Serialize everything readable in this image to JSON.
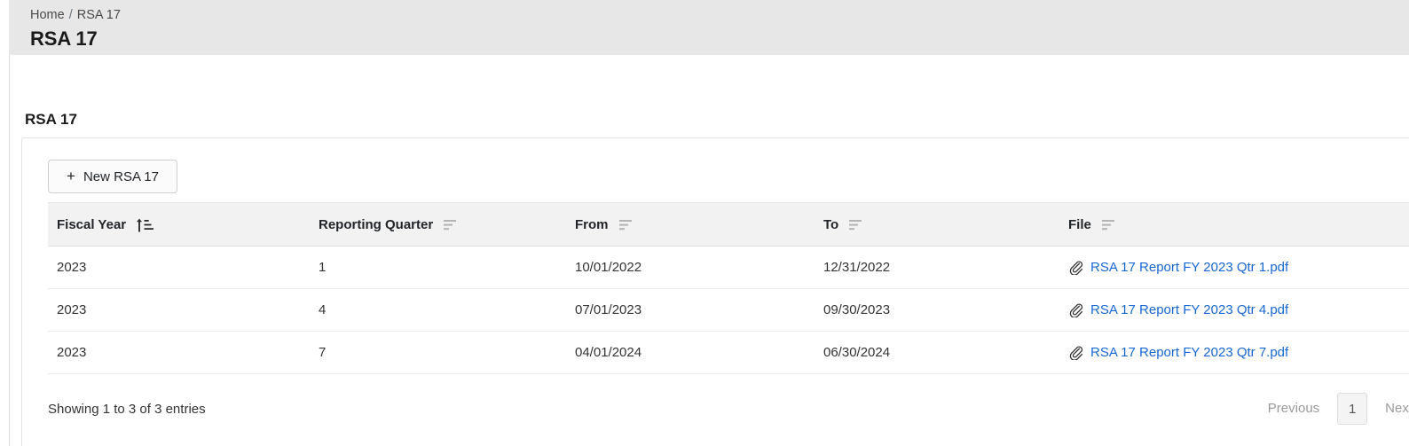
{
  "header": {
    "breadcrumb": {
      "home": "Home",
      "separator": "/",
      "current": "RSA 17"
    },
    "title": "RSA 17"
  },
  "section": {
    "title": "RSA 17"
  },
  "toolbar": {
    "new_button_label": "New RSA 17",
    "new_button_icon": "plus-icon"
  },
  "table": {
    "columns": [
      {
        "label": "Fiscal Year",
        "sort_icon": "sort-ascending-icon",
        "sort_state": "asc"
      },
      {
        "label": "Reporting Quarter",
        "sort_icon": "sort-icon",
        "sort_state": "none"
      },
      {
        "label": "From",
        "sort_icon": "sort-icon",
        "sort_state": "none"
      },
      {
        "label": "To",
        "sort_icon": "sort-icon",
        "sort_state": "none"
      },
      {
        "label": "File",
        "sort_icon": "sort-icon",
        "sort_state": "none"
      }
    ],
    "rows": [
      {
        "fiscal_year": "2023",
        "reporting_quarter": "1",
        "from": "10/01/2022",
        "to": "12/31/2022",
        "file_name": "RSA 17 Report FY 2023 Qtr 1.pdf",
        "file_icon": "paperclip-icon"
      },
      {
        "fiscal_year": "2023",
        "reporting_quarter": "4",
        "from": "07/01/2023",
        "to": "09/30/2023",
        "file_name": "RSA 17 Report FY 2023 Qtr 4.pdf",
        "file_icon": "paperclip-icon"
      },
      {
        "fiscal_year": "2023",
        "reporting_quarter": "7",
        "from": "04/01/2024",
        "to": "06/30/2024",
        "file_name": "RSA 17 Report FY 2023 Qtr 7.pdf",
        "file_icon": "paperclip-icon"
      }
    ]
  },
  "footer": {
    "showing_text": "Showing 1 to 3 of 3 entries",
    "previous_label": "Previous",
    "current_page": "1",
    "next_label": "Next"
  },
  "colors": {
    "header_band": "#e7e7e7",
    "link": "#1867d1",
    "table_header_bg": "#f2f2f2",
    "muted_text": "#9a9a9a"
  }
}
